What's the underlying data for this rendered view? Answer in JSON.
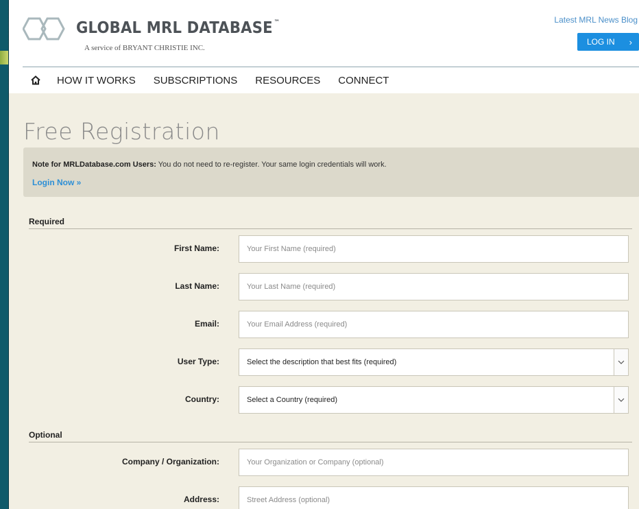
{
  "header": {
    "logo_title": "GLOBAL MRL DATABASE",
    "logo_tm": "™",
    "logo_subtitle": "A service of BRYANT CHRISTIE INC.",
    "news_link": "Latest MRL News Blog",
    "login_button": "LOG IN",
    "login_chevron": "›"
  },
  "nav": {
    "items": [
      {
        "label": "HOW IT WORKS"
      },
      {
        "label": "SUBSCRIPTIONS"
      },
      {
        "label": "RESOURCES"
      },
      {
        "label": "CONNECT"
      }
    ]
  },
  "main": {
    "title": "Free Registration",
    "note": {
      "bold": "Note for MRLDatabase.com Users:",
      "text": " You do not need to re-register. Your same login credentials will work.",
      "link": "Login Now »"
    },
    "required_heading": "Required",
    "optional_heading": "Optional",
    "fields": {
      "first_name": {
        "label": "First Name:",
        "placeholder": "Your First Name (required)"
      },
      "last_name": {
        "label": "Last Name:",
        "placeholder": "Your Last Name (required)"
      },
      "email": {
        "label": "Email:",
        "placeholder": "Your Email Address (required)"
      },
      "user_type": {
        "label": "User Type:",
        "value": "Select the description that best fits (required)"
      },
      "country": {
        "label": "Country:",
        "value": "Select a Country (required)"
      },
      "company": {
        "label": "Company / Organization:",
        "placeholder": "Your Organization or Company (optional)"
      },
      "address": {
        "label": "Address:",
        "placeholder": "Street Address (optional)"
      }
    }
  },
  "colors": {
    "accent": "#1c8fe0",
    "frame": "#145f70",
    "content_bg": "#f2efe3"
  }
}
